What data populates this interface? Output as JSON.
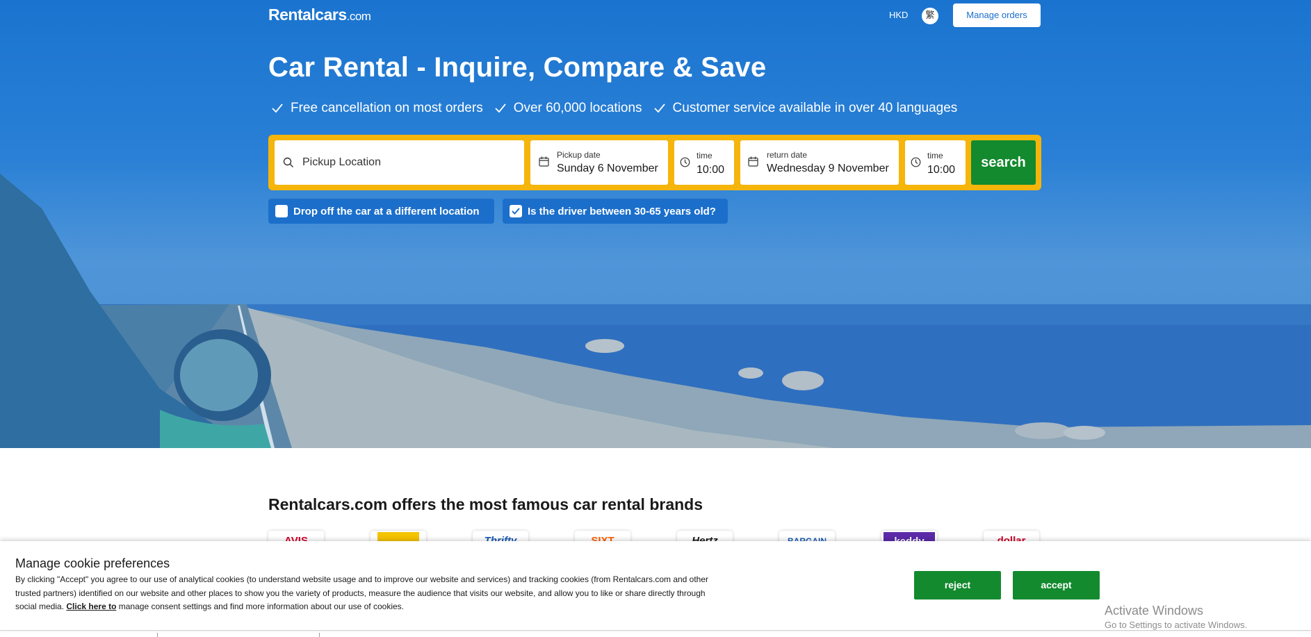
{
  "header": {
    "logo_main": "Rentalcars",
    "logo_suffix": ".com",
    "currency": "HKD",
    "language_glyph": "繁",
    "manage_orders": "Manage orders"
  },
  "hero": {
    "title": "Car Rental - Inquire, Compare & Save",
    "benefits": [
      "Free cancellation on most orders",
      "Over 60,000 locations",
      "Customer service available in over 40 languages"
    ]
  },
  "search": {
    "pickup_location_placeholder": "Pickup Location",
    "pickup_date_label": "Pickup date",
    "pickup_date_value": "Sunday 6 November",
    "pickup_time_label": "time",
    "pickup_time_value": "10:00",
    "return_date_label": "return date",
    "return_date_value": "Wednesday 9 November",
    "return_time_label": "time",
    "return_time_value": "10:00",
    "search_button": "search",
    "accent_color": "#f5b50a",
    "button_color": "#138a2e"
  },
  "options": {
    "different_location": {
      "label": "Drop off the car at a different location",
      "checked": false
    },
    "driver_age": {
      "label": "Is the driver between 30-65 years old?",
      "checked": true
    }
  },
  "brands": {
    "title": "Rentalcars.com offers the most famous car rental brands",
    "items": [
      {
        "name": "avis-logo",
        "text": "AVIS",
        "color": "#d4002a"
      },
      {
        "name": "thrifty-logo",
        "text": "Thrifty",
        "color": "#1c5bb4"
      },
      {
        "name": "sixt-logo",
        "text": "SIXT",
        "color": "#ff5f00"
      },
      {
        "name": "hertz-logo",
        "text": "Hertz",
        "color": "#1a1a1a"
      },
      {
        "name": "bargain-logo",
        "text": "BARGAIN",
        "color": "#1c5bb4"
      },
      {
        "name": "keddy-logo",
        "text": "keddy",
        "color": "#ffffff"
      },
      {
        "name": "dollar-logo",
        "text": "dollar",
        "color": "#d4002a"
      }
    ]
  },
  "cookie": {
    "title": "Manage cookie preferences",
    "text_before_link": "By clicking \"Accept\" you agree to our use of analytical cookies (to understand website usage and to improve our website and services) and tracking cookies (from Rentalcars.com and other trusted partners) identified on our website and other places to show you the variety of products, measure the audience that visits our website, and allow you to like or share directly through social media.",
    "link_text": "Click here to",
    "text_after_link": "manage consent settings and find more information about our use of cookies.",
    "reject": "reject",
    "accept": "accept"
  },
  "windows_watermark": {
    "line1": "Activate Windows",
    "line2": "Go to Settings to activate Windows."
  }
}
